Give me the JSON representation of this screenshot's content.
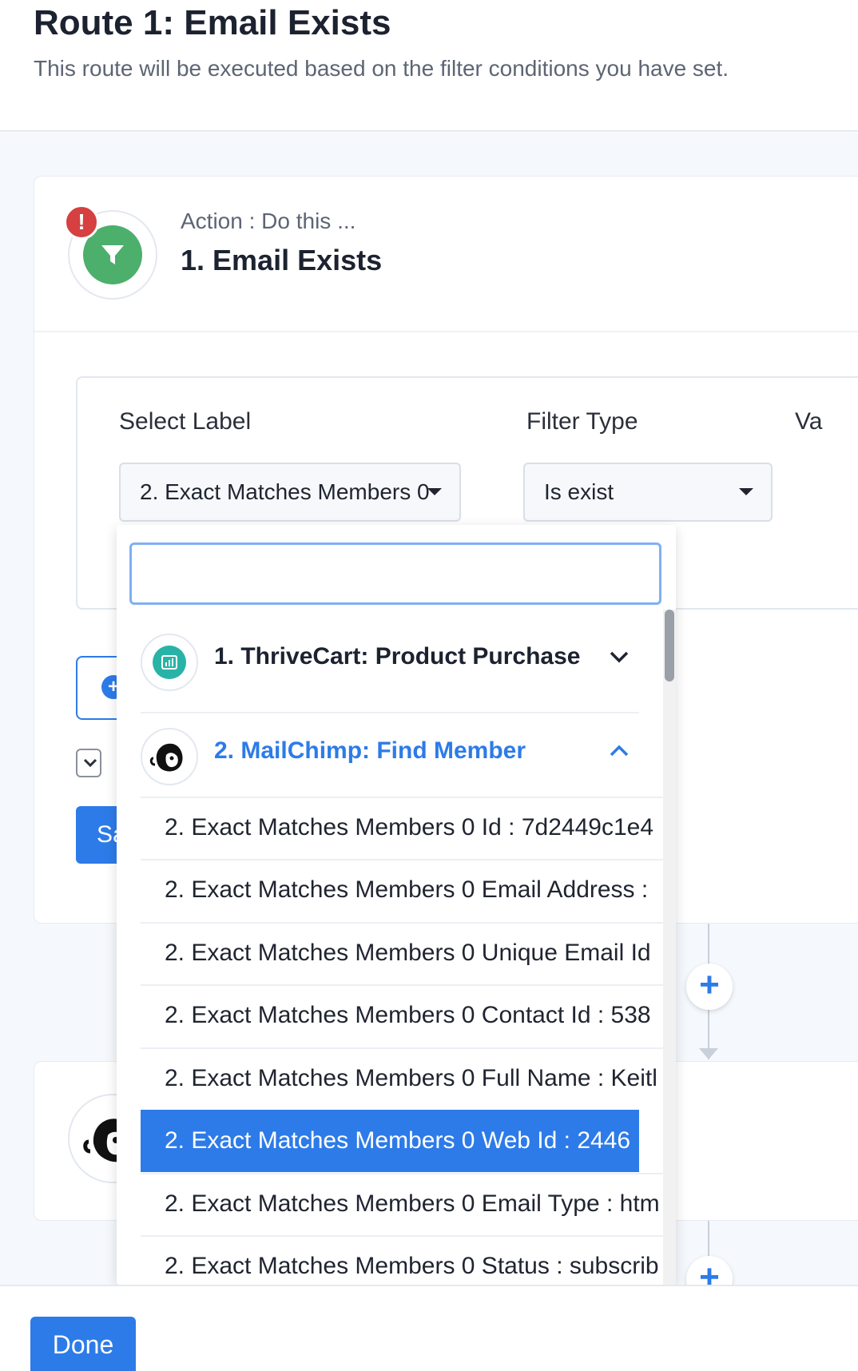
{
  "header": {
    "title": "Route 1: Email Exists",
    "subtitle": "This route will be executed based on the filter conditions you have set."
  },
  "action_card": {
    "kicker": "Action : Do this ...",
    "title": "1. Email Exists",
    "error_badge": "!",
    "filter": {
      "select_label": "Select Label",
      "select_value": "2. Exact Matches Members 0",
      "filter_type_label": "Filter Type",
      "filter_type_value": "Is exist",
      "value_label": "Va"
    },
    "add_filter_icon": "+",
    "save_label": "Sa"
  },
  "add_step_icon": "+",
  "dropdown": {
    "search_value": "",
    "groups": [
      {
        "label": "1. ThriveCart: Product Purchase",
        "expanded": false,
        "icon": "thrivecart-icon"
      },
      {
        "label": "2. MailChimp: Find Member",
        "expanded": true,
        "icon": "mailchimp-icon"
      }
    ],
    "options": [
      "2. Exact Matches Members 0 Id : 7d2449c1e4",
      "2. Exact Matches Members 0 Email Address : ",
      "2. Exact Matches Members 0 Unique Email Id",
      "2. Exact Matches Members 0 Contact Id : 538",
      "2. Exact Matches Members 0 Full Name : Keitl",
      "2. Exact Matches Members 0 Web Id : 2446",
      "2. Exact Matches Members 0 Email Type : htm",
      "2. Exact Matches Members 0 Status : subscrib"
    ],
    "selected_index": 5
  },
  "footer": {
    "done_label": "Done"
  },
  "colors": {
    "accent": "#2d7be8",
    "filter_green": "#4caf6b",
    "error_red": "#d64040",
    "thrivecart_teal": "#29b3a7"
  }
}
